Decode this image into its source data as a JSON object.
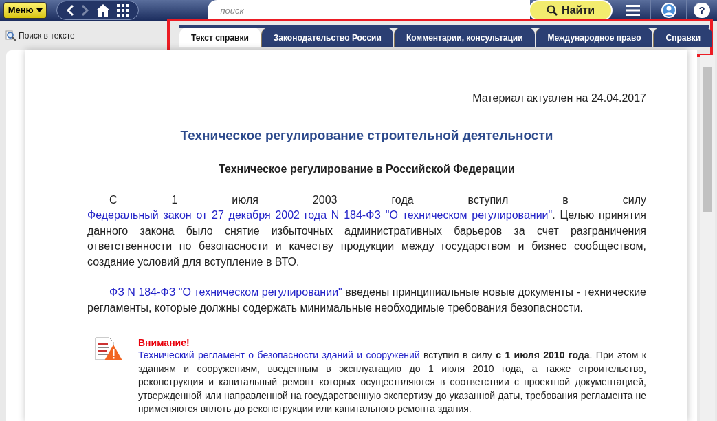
{
  "toolbar": {
    "menu_button": "Меню",
    "search": {
      "placeholder": "поиск"
    },
    "find_button": "Найти",
    "help_button": "?"
  },
  "find_in_text": "Поиск в тексте",
  "tabs": [
    {
      "label": "Текст справки",
      "selected": true
    },
    {
      "label": "Законодательство России",
      "selected": false
    },
    {
      "label": "Комментарии, консультации",
      "selected": false
    },
    {
      "label": "Международное право",
      "selected": false
    },
    {
      "label": "Справки",
      "selected": false
    }
  ],
  "document": {
    "date_note": "Материал актуален на 24.04.2017",
    "title": "Техническое регулирование строительной деятельности",
    "subtitle": "Техническое регулирование в Российской Федерации",
    "paragraphs": [
      [
        {
          "kind": "text",
          "text": "С 1 июля 2003 года вступил в силу "
        },
        {
          "kind": "link",
          "text": "Федеральный закон от 27 декабря 2002 года N 184-ФЗ \"О техническом регулировании\""
        },
        {
          "kind": "text",
          "text": ". Целью принятия данного закона было снятие избыточных административных барьеров за счет разграничения ответственности по безопасности и качеству продукции между государством и бизнес сообществом, создание условий для вступление в ВТО."
        }
      ],
      [
        {
          "kind": "link",
          "text": "ФЗ N 184-ФЗ \"О техническом регулировании\""
        },
        {
          "kind": "text",
          "text": " введены принципиальные новые документы - технические регламенты, которые должны содержать минимальные необходимые требования безопасности."
        }
      ]
    ],
    "notice": {
      "heading": "Внимание!",
      "body": [
        {
          "kind": "link",
          "text": "Технический регламент о безопасности зданий и сооружений"
        },
        {
          "kind": "text",
          "text": " вступил в силу **с 1 июля 2010 года**. При этом к зданиям и сооружениям, введенным в эксплуатацию до 1 июля 2010 года, а также строительство, реконструкция и капитальный ремонт которых осуществляются в соответствии с проектной документацией, утвержденной или направленной на государственную экспертизу до указанной даты, требования регламента не применяются вплоть до реконструкции или капитального ремонта здания."
        }
      ]
    }
  }
}
